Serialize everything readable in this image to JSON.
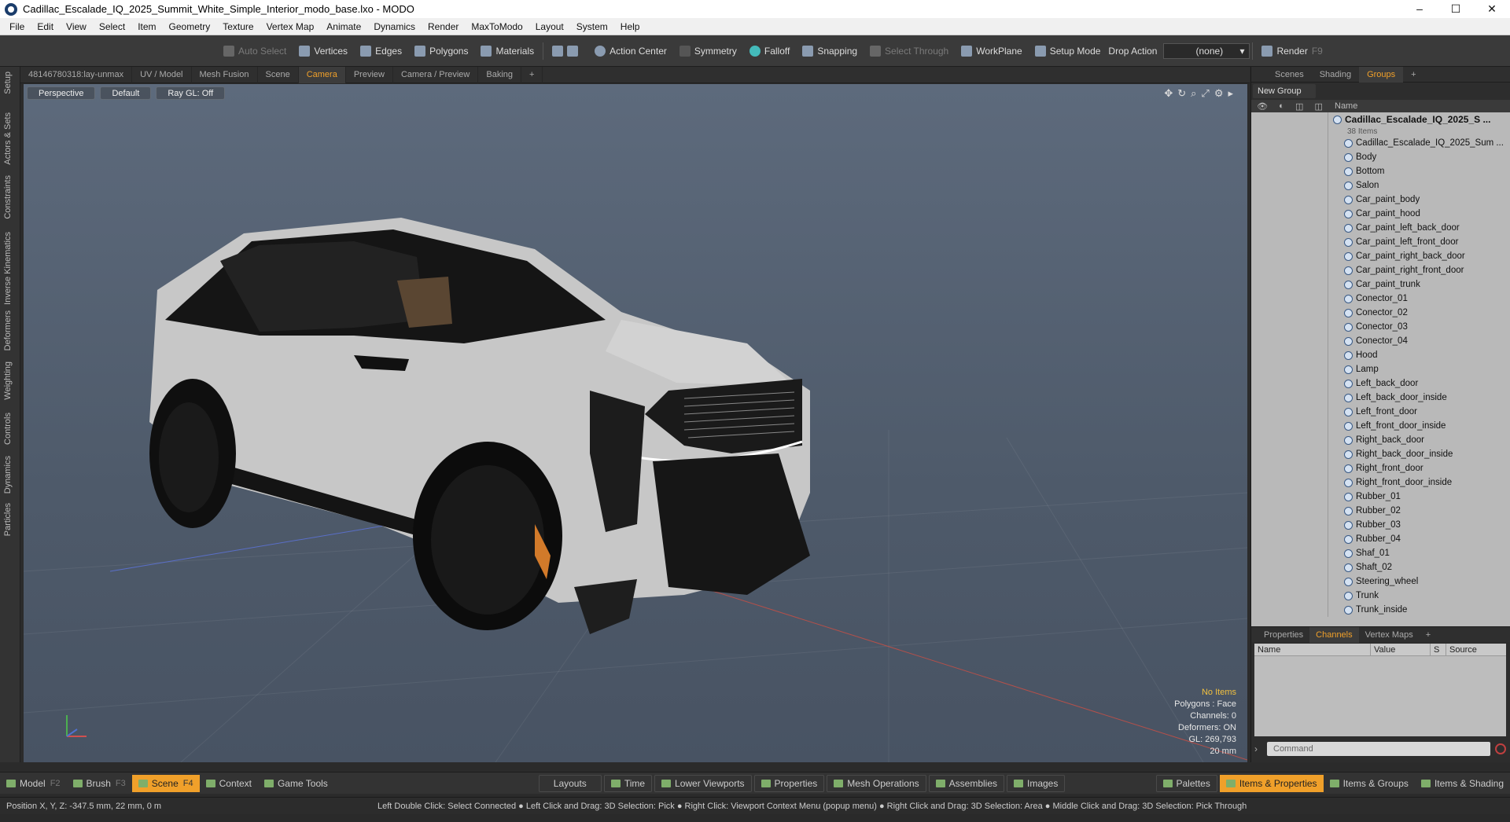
{
  "window": {
    "title": "Cadillac_Escalade_IQ_2025_Summit_White_Simple_Interior_modo_base.lxo - MODO",
    "min": "–",
    "max": "☐",
    "close": "✕"
  },
  "menu": [
    "File",
    "Edit",
    "View",
    "Select",
    "Item",
    "Geometry",
    "Texture",
    "Vertex Map",
    "Animate",
    "Dynamics",
    "Render",
    "MaxToModo",
    "Layout",
    "System",
    "Help"
  ],
  "toolbar": {
    "auto_select": "Auto Select",
    "vertices": "Vertices",
    "edges": "Edges",
    "polygons": "Polygons",
    "materials": "Materials",
    "action_center": "Action Center",
    "symmetry": "Symmetry",
    "falloff": "Falloff",
    "snapping": "Snapping",
    "select_through": "Select Through",
    "workplane": "WorkPlane",
    "setup_mode": "Setup Mode",
    "drop_action": "Drop Action",
    "drop_value": "(none)",
    "render": "Render",
    "render_key": "F9"
  },
  "left_tabs": [
    "Setup",
    "Actors & Sets",
    "Constraints",
    "Inverse Kinematics",
    "Deformers",
    "Weighting",
    "Controls",
    "Dynamics",
    "Particles"
  ],
  "viewport_tabs": [
    "48146780318:lay-unmax",
    "UV / Model",
    "Mesh Fusion",
    "Scene",
    "Camera",
    "Preview",
    "Camera / Preview",
    "Baking",
    "+"
  ],
  "viewport_active_tab": "Camera",
  "viewport": {
    "view": "Perspective",
    "shading": "Default",
    "raygl": "Ray GL: Off"
  },
  "hud": {
    "selection": "No Items",
    "polygons": "Polygons : Face",
    "channels": "Channels: 0",
    "deformers": "Deformers: ON",
    "gl": "GL: 269,793",
    "scale": "20 mm"
  },
  "right_tabs": [
    "Scenes",
    "Shading",
    "Groups",
    "+"
  ],
  "right_active_tab": "Groups",
  "groups": {
    "new_group": "New Group",
    "name_col": "Name",
    "group_name": "Cadillac_Escalade_IQ_2025_S ...",
    "group_count": "38 Items",
    "items": [
      "Cadillac_Escalade_IQ_2025_Sum ...",
      "Body",
      "Bottom",
      "Salon",
      "Car_paint_body",
      "Car_paint_hood",
      "Car_paint_left_back_door",
      "Car_paint_left_front_door",
      "Car_paint_right_back_door",
      "Car_paint_right_front_door",
      "Car_paint_trunk",
      "Conector_01",
      "Conector_02",
      "Conector_03",
      "Conector_04",
      "Hood",
      "Lamp",
      "Left_back_door",
      "Left_back_door_inside",
      "Left_front_door",
      "Left_front_door_inside",
      "Right_back_door",
      "Right_back_door_inside",
      "Right_front_door",
      "Right_front_door_inside",
      "Rubber_01",
      "Rubber_02",
      "Rubber_03",
      "Rubber_04",
      "Shaf_01",
      "Shaft_02",
      "Steering_wheel",
      "Trunk",
      "Trunk_inside"
    ]
  },
  "channel_tabs": [
    "Properties",
    "Channels",
    "Vertex Maps",
    "+"
  ],
  "channel_active_tab": "Channels",
  "channels": {
    "name": "Name",
    "value": "Value",
    "s": "S",
    "source": "Source"
  },
  "command_placeholder": "Command",
  "bottom": {
    "model": "Model",
    "model_key": "F2",
    "brush": "Brush",
    "brush_key": "F3",
    "scene": "Scene",
    "scene_key": "F4",
    "context": "Context",
    "game_tools": "Game Tools",
    "layouts": "Layouts",
    "time": "Time",
    "lower_viewports": "Lower Viewports",
    "properties": "Properties",
    "mesh_operations": "Mesh Operations",
    "assemblies": "Assemblies",
    "images": "Images",
    "palettes": "Palettes",
    "items_properties": "Items & Properties",
    "items_groups": "Items & Groups",
    "items_shading": "Items & Shading"
  },
  "status": {
    "position": "Position X, Y, Z:  -347.5 mm, 22 mm, 0 m",
    "hint": "Left Double Click: Select Connected ● Left Click and Drag: 3D Selection: Pick ● Right Click: Viewport Context Menu (popup menu) ● Right Click and Drag: 3D Selection: Area ● Middle Click and Drag: 3D Selection: Pick Through"
  },
  "colors": {
    "accent": "#f0a02a",
    "viewport_bg": "#56626f",
    "car_body": "#c9c9c9"
  }
}
